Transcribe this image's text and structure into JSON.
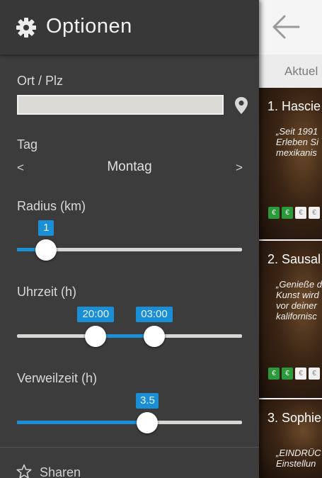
{
  "drawer": {
    "title": "Optionen",
    "ort": {
      "label": "Ort / Plz",
      "value": "",
      "placeholder": ""
    },
    "tag": {
      "label": "Tag",
      "prev": "<",
      "next": ">",
      "value": "Montag"
    },
    "radius": {
      "label": "Radius (km)",
      "value": "1",
      "fraction": 0.13
    },
    "uhrzeit": {
      "label": "Uhrzeit (h)",
      "start": "20:00",
      "end": "03:00",
      "start_fraction": 0.35,
      "end_fraction": 0.61
    },
    "verweilzeit": {
      "label": "Verweilzeit (h)",
      "value": "3.5",
      "fraction": 0.58
    },
    "share_label": "Sharen"
  },
  "main": {
    "tab_label": "Aktuel",
    "cards": [
      {
        "title": "1. Hascie",
        "text": "„Seit 1991\nErleben Si\nmexikanis",
        "price": [
          "€",
          "€",
          "€",
          "€"
        ]
      },
      {
        "title": "2. Sausal",
        "text": "„Genieße d\nKunst wird\nvor deiner\nkalifornisc",
        "price": [
          "€",
          "€",
          "€",
          "€"
        ]
      },
      {
        "title": "3. Sophie",
        "text": "„EINDRÜC\nEinstellun",
        "price": []
      }
    ]
  },
  "colors": {
    "accent": "#1a8fd6",
    "drawer_bg": "#3c3c3c",
    "price_green": "#2a9a3a"
  }
}
